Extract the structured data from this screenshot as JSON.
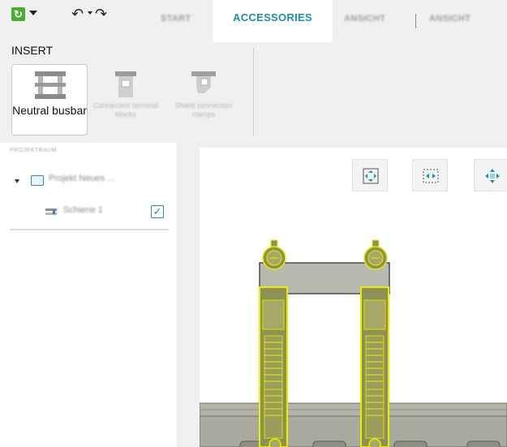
{
  "toolbar": {
    "app_icon": "app-menu-icon",
    "undo_icon": "undo-icon",
    "redo_icon": "redo-icon"
  },
  "tabs": [
    {
      "label": "START",
      "active": false,
      "blurred": true
    },
    {
      "label": "ACCESSORIES",
      "active": true,
      "blurred": false
    },
    {
      "label": "ANSICHT",
      "active": false,
      "blurred": true
    },
    {
      "label": "ANSICHT",
      "active": false,
      "blurred": true
    }
  ],
  "ribbon": {
    "group_label": "INSERT",
    "buttons": [
      {
        "label": "Neutral busbar",
        "icon": "neutral-busbar-icon",
        "enabled": true
      },
      {
        "label": "Connection terminal blocks",
        "icon": "connection-terminal-icon",
        "enabled": false
      },
      {
        "label": "Shield connection clamps",
        "icon": "shield-clamp-icon",
        "enabled": false
      }
    ]
  },
  "project_panel": {
    "title": "PROJEKTBAUM",
    "project_label": "Projekt Neues ...",
    "item_label": "Schiene 1",
    "item_checked": true
  },
  "viewport": {
    "buttons": [
      "fit-view-icon",
      "zoom-extents-icon",
      "center-view-icon"
    ]
  },
  "colors": {
    "accent": "#1d8fa7",
    "selection": "#e6ee00",
    "rail": "#a9a99e",
    "background": "#f0f0f0"
  }
}
